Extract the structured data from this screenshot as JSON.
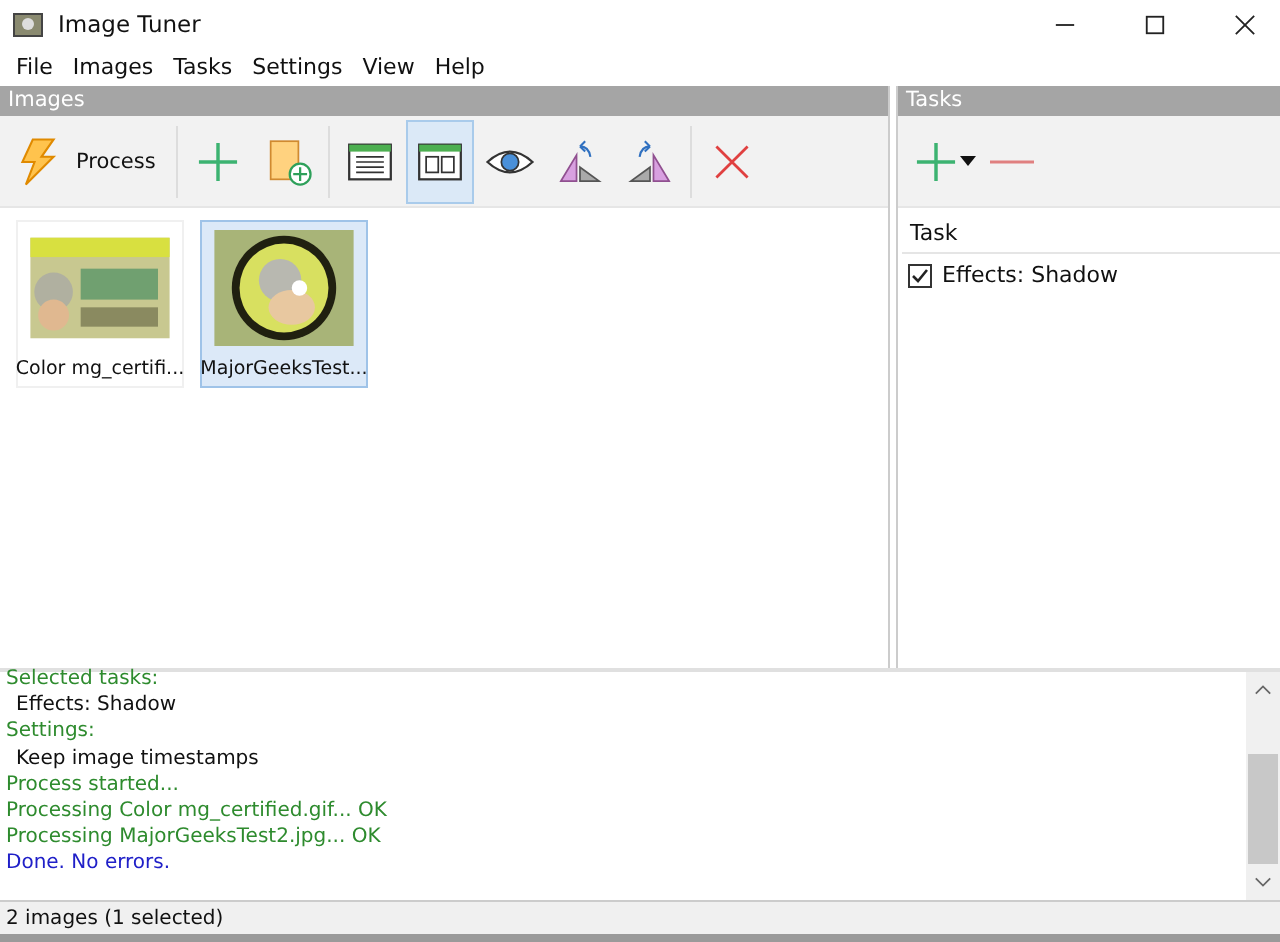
{
  "window": {
    "title": "Image Tuner"
  },
  "menu": [
    "File",
    "Images",
    "Tasks",
    "Settings",
    "View",
    "Help"
  ],
  "images_panel": {
    "title": "Images"
  },
  "toolbar": {
    "process_label": "Process",
    "view_buttons": [
      {
        "selected": false
      },
      {
        "selected": true
      }
    ]
  },
  "thumbnails": [
    {
      "caption": "Color mg_certifi...",
      "selected": false,
      "kind": "picture"
    },
    {
      "caption": "MajorGeeksTest...",
      "selected": true,
      "kind": "picture"
    }
  ],
  "tasks_panel": {
    "title": "Tasks",
    "column": "Task",
    "tasks": [
      {
        "label": "Effects: Shadow",
        "checked": true
      }
    ]
  },
  "log": [
    {
      "text": "Selected tasks:",
      "kind": "heading"
    },
    {
      "text": "Effects: Shadow",
      "kind": "item"
    },
    {
      "text": "Settings:",
      "kind": "heading"
    },
    {
      "text": "Keep image timestamps",
      "kind": "item"
    },
    {
      "text": "Process started...",
      "kind": "heading"
    },
    {
      "text": "Processing Color mg_certified.gif... OK",
      "kind": "heading"
    },
    {
      "text": "Processing MajorGeeksTest2.jpg... OK",
      "kind": "heading"
    },
    {
      "text": "Done. No errors.",
      "kind": "done"
    }
  ],
  "status_bar": "2 images (1 selected)"
}
